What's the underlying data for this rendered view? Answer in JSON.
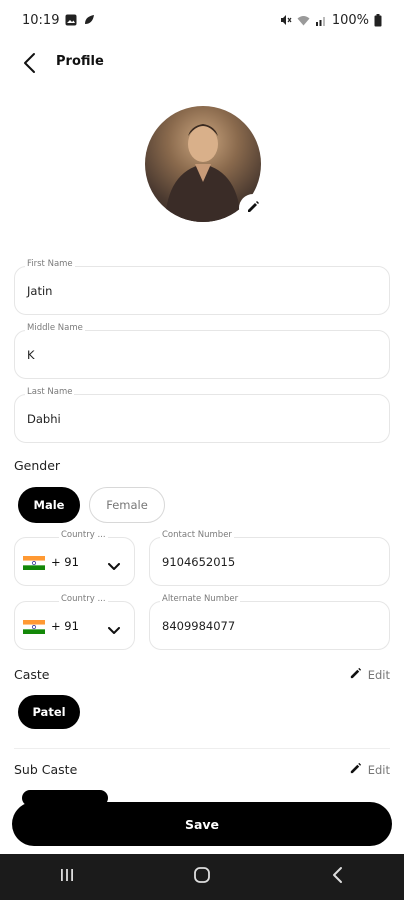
{
  "status_bar": {
    "time": "10:19",
    "battery": "100%"
  },
  "header": {
    "title": "Profile"
  },
  "form": {
    "first_name": {
      "label": "First Name",
      "value": "Jatin"
    },
    "middle_name": {
      "label": "Middle Name",
      "value": "K"
    },
    "last_name": {
      "label": "Last Name",
      "value": "Dabhi"
    },
    "gender": {
      "label": "Gender",
      "options": [
        "Male",
        "Female"
      ],
      "selected": "Male"
    },
    "contact": {
      "country_label": "Country ...",
      "code": "+ 91",
      "label": "Contact Number",
      "value": "9104652015"
    },
    "alternate": {
      "country_label": "Country ...",
      "code": "+ 91",
      "label": "Alternate Number",
      "value": "8409984077"
    }
  },
  "caste": {
    "label": "Caste",
    "edit": "Edit",
    "value": "Patel"
  },
  "sub_caste": {
    "label": "Sub Caste",
    "edit": "Edit"
  },
  "save": "Save",
  "colors": {
    "primary": "#000000",
    "nav_bg": "#1b1b1b",
    "border": "#e6e6e6"
  },
  "icons": [
    "back-arrow-icon",
    "pencil-icon",
    "chevron-down-icon",
    "india-flag-icon"
  ]
}
